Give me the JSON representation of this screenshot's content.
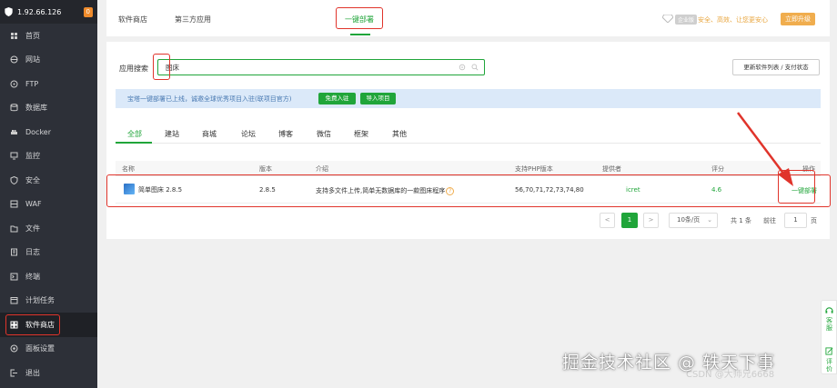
{
  "sidebar": {
    "ip": "1.92.66.126",
    "badge": "0",
    "items": [
      {
        "label": "首页",
        "icon": "home-icon"
      },
      {
        "label": "网站",
        "icon": "globe-icon"
      },
      {
        "label": "FTP",
        "icon": "ftp-icon"
      },
      {
        "label": "数据库",
        "icon": "database-icon"
      },
      {
        "label": "Docker",
        "icon": "docker-icon"
      },
      {
        "label": "监控",
        "icon": "monitor-icon"
      },
      {
        "label": "安全",
        "icon": "shield-icon"
      },
      {
        "label": "WAF",
        "icon": "waf-icon"
      },
      {
        "label": "文件",
        "icon": "folder-icon"
      },
      {
        "label": "日志",
        "icon": "log-icon"
      },
      {
        "label": "终端",
        "icon": "terminal-icon"
      },
      {
        "label": "计划任务",
        "icon": "clock-icon"
      },
      {
        "label": "软件商店",
        "icon": "grid-icon"
      },
      {
        "label": "面板设置",
        "icon": "settings-icon"
      },
      {
        "label": "退出",
        "icon": "logout-icon"
      }
    ]
  },
  "top_tabs": [
    "软件商店",
    "第三方应用",
    "一键部署"
  ],
  "pro": {
    "badge": "企业版",
    "text": "安全、高效、让您更安心",
    "button": "立即升级"
  },
  "search": {
    "label": "应用搜索",
    "value": "图床",
    "refresh": "更新软件列表 / 支付状态"
  },
  "notice": {
    "text": "宝塔一键部署已上线，诚邀全球优秀项目入驻(联项目官方)",
    "btn1": "免费入驻",
    "btn2": "导入项目"
  },
  "categories": [
    "全部",
    "建站",
    "商城",
    "论坛",
    "博客",
    "微信",
    "框架",
    "其他"
  ],
  "table": {
    "headers": {
      "name": "名称",
      "version": "版本",
      "intro": "介绍",
      "php": "支持PHP版本",
      "provider": "提供者",
      "score": "评分",
      "op": "操作"
    },
    "row": {
      "name": "简单图床 2.8.5",
      "version": "2.8.5",
      "intro": "支持多文件上传,简单无数据库的一款图床程序",
      "php": "56,70,71,72,73,74,80",
      "provider": "icret",
      "score": "4.6",
      "op": "一键部署"
    }
  },
  "pagination": {
    "current": "1",
    "per_page": "10条/页",
    "total": "共 1 条",
    "goto_label": "前往",
    "goto_value": "1",
    "page_suffix": "页"
  },
  "float": {
    "a": "客服",
    "b": "评价"
  },
  "watermark": "掘金技术社区 @ 轶天下事",
  "watermark2": "CSDN @大师兄6668",
  "colors": {
    "accent": "#20a53a",
    "highlight": "#e0342b",
    "sidebar": "#2d3038"
  }
}
